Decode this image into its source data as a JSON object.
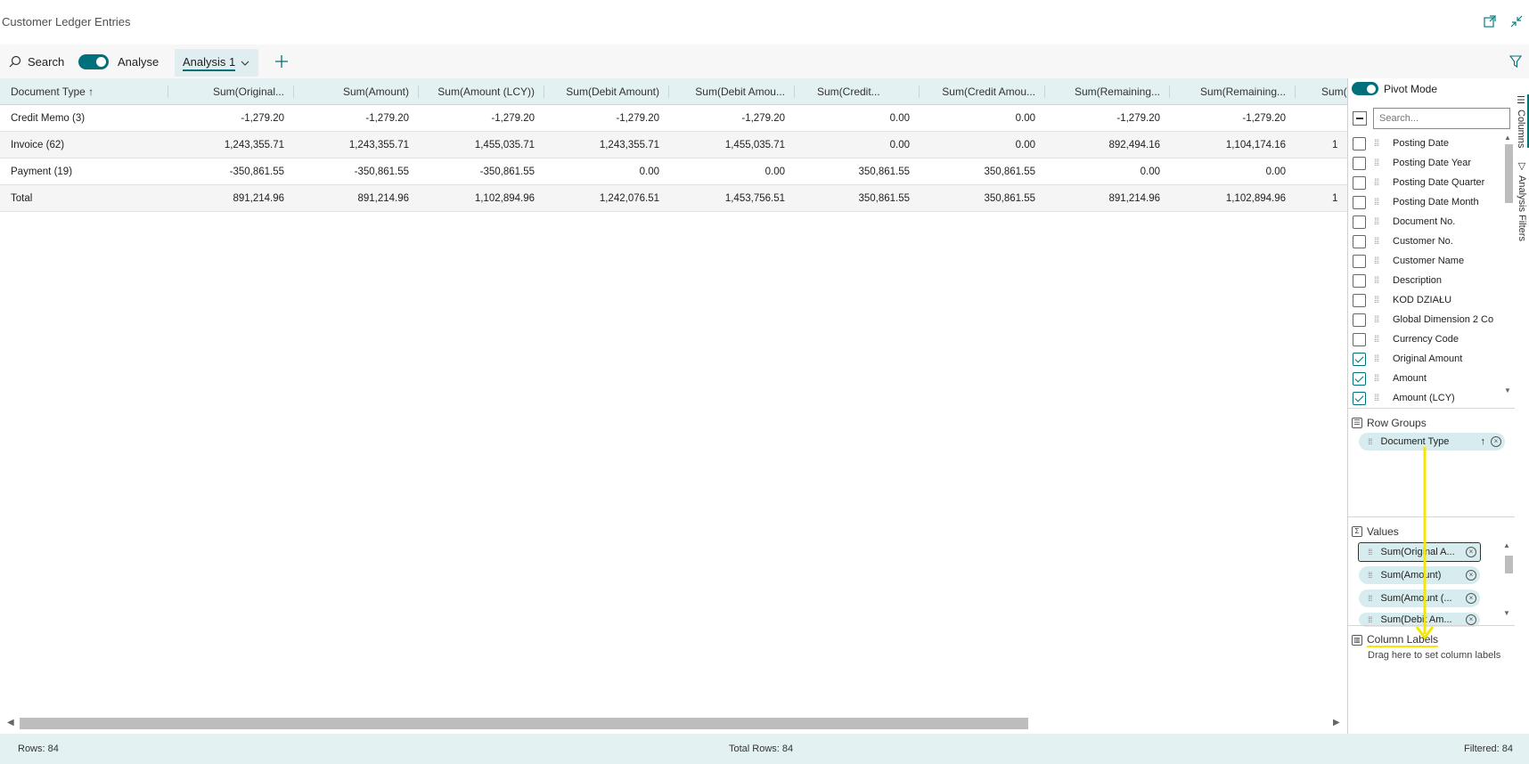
{
  "window": {
    "title": "Customer Ledger Entries"
  },
  "toolbar": {
    "search_label": "Search",
    "analyse_label": "Analyse",
    "tab_label": "Analysis 1"
  },
  "grid": {
    "headers": [
      "Document Type",
      "Sum(Original...",
      "Sum(Amount)",
      "Sum(Amount (LCY))",
      "Sum(Debit Amount)",
      "Sum(Debit Amou...",
      "Sum(Credit...",
      "Sum(Credit Amou...",
      "Sum(Remaining...",
      "Sum(Remaining...",
      "Sum("
    ],
    "rows": [
      [
        "Credit Memo (3)",
        "-1,279.20",
        "-1,279.20",
        "-1,279.20",
        "-1,279.20",
        "-1,279.20",
        "0.00",
        "0.00",
        "-1,279.20",
        "-1,279.20",
        ""
      ],
      [
        "Invoice (62)",
        "1,243,355.71",
        "1,243,355.71",
        "1,455,035.71",
        "1,243,355.71",
        "1,455,035.71",
        "0.00",
        "0.00",
        "892,494.16",
        "1,104,174.16",
        "1"
      ],
      [
        "Payment (19)",
        "-350,861.55",
        "-350,861.55",
        "-350,861.55",
        "0.00",
        "0.00",
        "350,861.55",
        "350,861.55",
        "0.00",
        "0.00",
        ""
      ],
      [
        "Total",
        "891,214.96",
        "891,214.96",
        "1,102,894.96",
        "1,242,076.51",
        "1,453,756.51",
        "350,861.55",
        "350,861.55",
        "891,214.96",
        "1,102,894.96",
        "1"
      ]
    ]
  },
  "panel": {
    "pivot_mode_label": "Pivot Mode",
    "search_placeholder": "Search...",
    "columns": [
      {
        "label": "Posting Date",
        "checked": false
      },
      {
        "label": "Posting Date Year",
        "checked": false
      },
      {
        "label": "Posting Date Quarter",
        "checked": false
      },
      {
        "label": "Posting Date Month",
        "checked": false
      },
      {
        "label": "Document No.",
        "checked": false
      },
      {
        "label": "Customer No.",
        "checked": false
      },
      {
        "label": "Customer Name",
        "checked": false
      },
      {
        "label": "Description",
        "checked": false
      },
      {
        "label": "KOD DZIAŁU",
        "checked": false
      },
      {
        "label": "Global Dimension 2 Co",
        "checked": false
      },
      {
        "label": "Currency Code",
        "checked": false
      },
      {
        "label": "Original Amount",
        "checked": true
      },
      {
        "label": "Amount",
        "checked": true
      },
      {
        "label": "Amount (LCY)",
        "checked": true
      }
    ],
    "row_groups_title": "Row Groups",
    "row_group_item": "Document Type",
    "values_title": "Values",
    "values_items": [
      "Sum(Original A...",
      "Sum(Amount)",
      "Sum(Amount (...",
      "Sum(Debit Am..."
    ],
    "column_labels_title": "Column Labels",
    "column_labels_hint": "Drag here to set column labels"
  },
  "vtabs": {
    "columns": "Columns",
    "filters": "Analysis Filters"
  },
  "status": {
    "rows": "Rows: 84",
    "total_rows": "Total Rows: 84",
    "filtered": "Filtered: 84"
  },
  "colors": {
    "accent": "#00707a",
    "header_bg": "#e3f1f3",
    "annotation": "#f5e700"
  }
}
